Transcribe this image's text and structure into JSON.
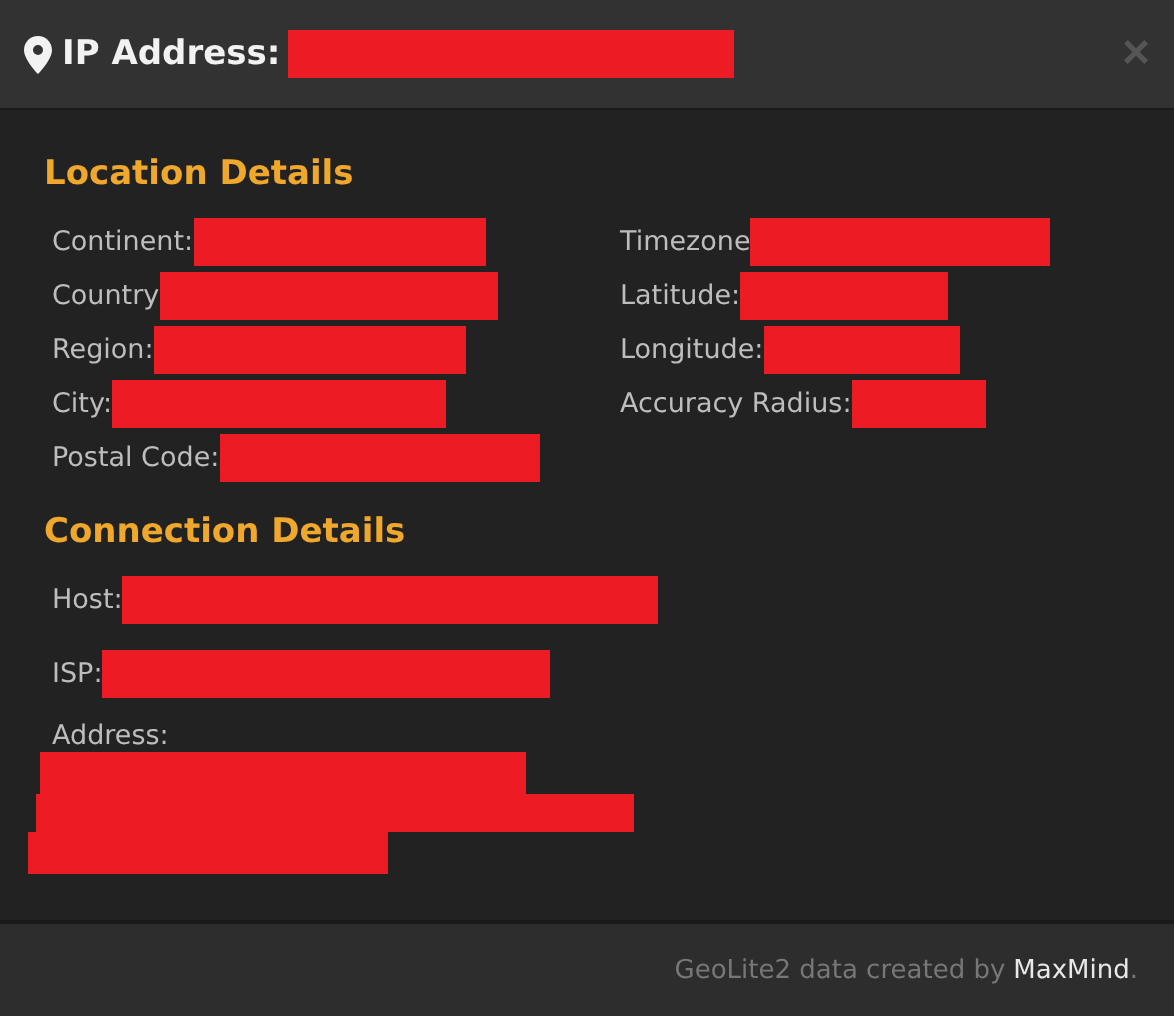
{
  "header": {
    "title": "IP Address:",
    "close": "×"
  },
  "location": {
    "title": "Location Details",
    "left": [
      {
        "label": "Continent:"
      },
      {
        "label": "Country"
      },
      {
        "label": "Region:"
      },
      {
        "label": "City:"
      },
      {
        "label": "Postal Code:"
      }
    ],
    "right": [
      {
        "label": "Timezone"
      },
      {
        "label": "Latitude:"
      },
      {
        "label": "Longitude:"
      },
      {
        "label": "Accuracy Radius:"
      }
    ]
  },
  "connection": {
    "title": "Connection Details",
    "fields": [
      {
        "label": "Host:"
      },
      {
        "label": "ISP:"
      }
    ],
    "address": {
      "label": "Address:"
    }
  },
  "footer": {
    "text": "GeoLite2 data created by",
    "link": "MaxMind",
    "suffix": "."
  }
}
